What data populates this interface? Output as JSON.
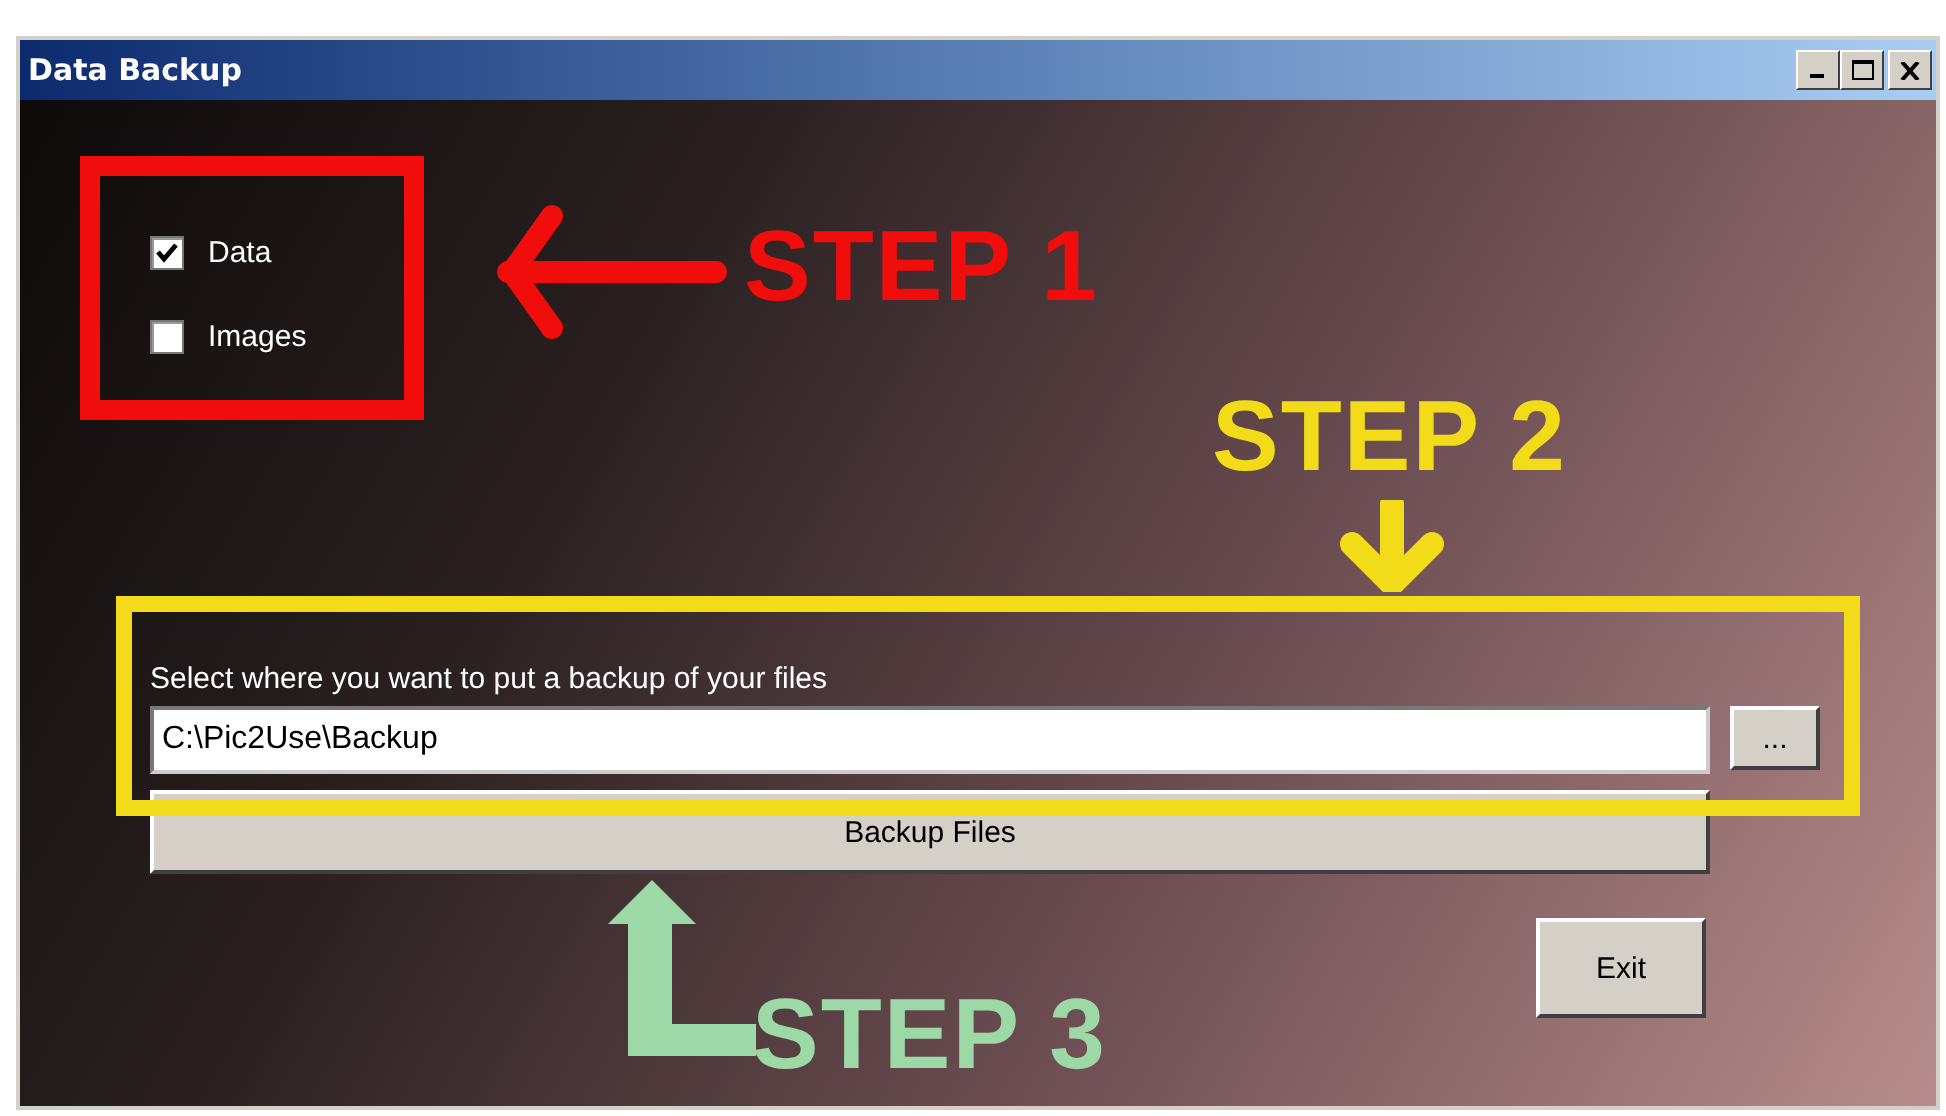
{
  "window": {
    "title": "Data Backup"
  },
  "checkboxes": [
    {
      "label": "Data",
      "checked": true
    },
    {
      "label": "Images",
      "checked": false
    }
  ],
  "destination": {
    "label": "Select where you want to put a backup of your files",
    "value": "C:\\Pic2Use\\Backup",
    "browse_button": "..."
  },
  "buttons": [
    {
      "kind": "backup",
      "label": "Backup Files"
    },
    {
      "kind": "exit",
      "label": "Exit"
    }
  ],
  "annotations": [
    {
      "kind": "left",
      "text": "STEP 1",
      "color": "#f20d0d"
    },
    {
      "kind": "down",
      "text": "STEP 2",
      "color": "#f2dc1a"
    },
    {
      "kind": "up",
      "text": "STEP 3",
      "color": "#9dd9a6"
    }
  ]
}
